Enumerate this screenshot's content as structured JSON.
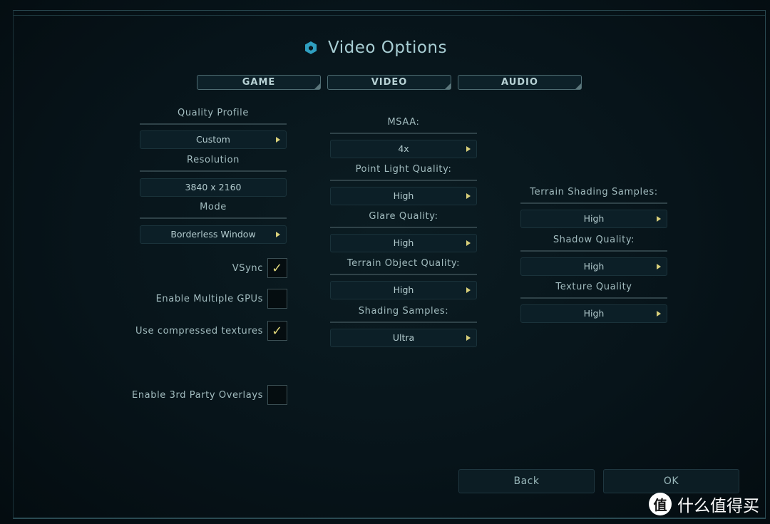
{
  "header": {
    "title": "Video Options",
    "icon": "hex-logo-icon"
  },
  "tabs": [
    {
      "label": "GAME"
    },
    {
      "label": "VIDEO"
    },
    {
      "label": "AUDIO"
    }
  ],
  "left": {
    "quality_profile": {
      "label": "Quality Profile",
      "value": "Custom"
    },
    "resolution": {
      "label": "Resolution",
      "value": "3840 x 2160"
    },
    "mode": {
      "label": "Mode",
      "value": "Borderless Window"
    },
    "checkboxes": [
      {
        "label": "VSync",
        "checked": true
      },
      {
        "label": "Enable Multiple GPUs",
        "checked": false
      },
      {
        "label": "Use compressed textures",
        "checked": true
      },
      {
        "label": "Enable 3rd Party Overlays",
        "checked": false
      }
    ]
  },
  "middle": [
    {
      "label": "MSAA:",
      "value": "4x"
    },
    {
      "label": "Point Light Quality:",
      "value": "High"
    },
    {
      "label": "Glare Quality:",
      "value": "High"
    },
    {
      "label": "Terrain Object Quality:",
      "value": "High"
    },
    {
      "label": "Shading Samples:",
      "value": "Ultra"
    }
  ],
  "right": [
    {
      "label": "Terrain Shading Samples:",
      "value": "High"
    },
    {
      "label": "Shadow Quality:",
      "value": "High"
    },
    {
      "label": "Texture Quality",
      "value": "High"
    }
  ],
  "footer": {
    "back": "Back",
    "ok": "OK"
  },
  "watermark": {
    "badge": "值",
    "text": "什么值得买"
  },
  "colors": {
    "accent_check": "#e1d87a",
    "background": "#07141a"
  }
}
